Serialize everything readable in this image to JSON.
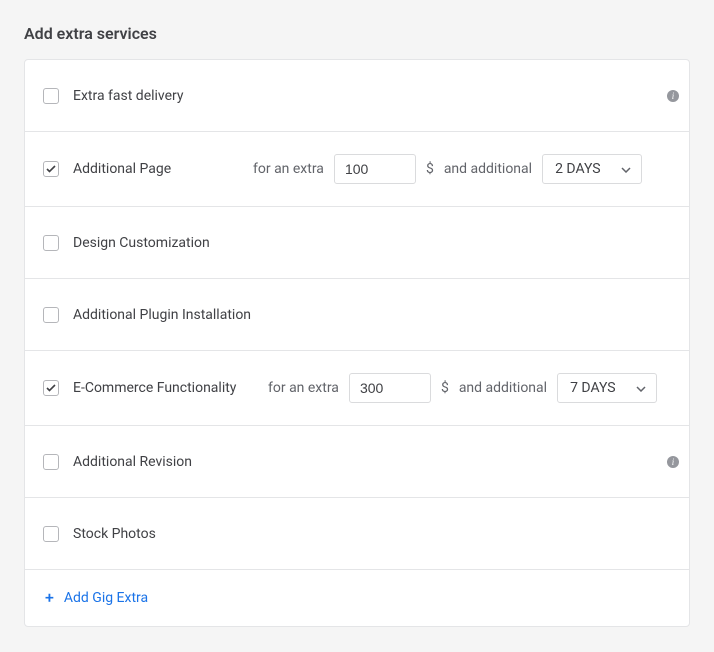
{
  "section_title": "Add extra services",
  "labels": {
    "for_extra": "for an extra",
    "currency": "$",
    "and_additional": "and additional"
  },
  "services": {
    "extra_fast": {
      "label": "Extra fast delivery",
      "checked": false,
      "info": true
    },
    "additional_page": {
      "label": "Additional Page",
      "checked": true,
      "price": "100",
      "duration": "2 DAYS"
    },
    "design_custom": {
      "label": "Design Customization",
      "checked": false
    },
    "plugin_install": {
      "label": "Additional Plugin Installation",
      "checked": false
    },
    "ecommerce": {
      "label": "E-Commerce Functionality",
      "checked": true,
      "price": "300",
      "duration": "7 DAYS"
    },
    "additional_revision": {
      "label": "Additional Revision",
      "checked": false,
      "info": true
    },
    "stock_photos": {
      "label": "Stock Photos",
      "checked": false
    }
  },
  "add_extra": {
    "label": "Add Gig Extra"
  }
}
